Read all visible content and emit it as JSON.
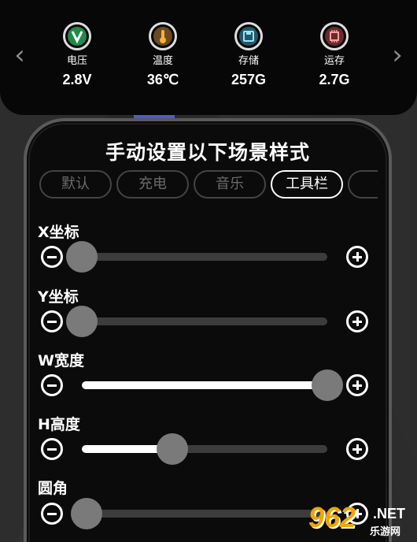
{
  "status": {
    "prev_arrow": "‹",
    "next_arrow": "›",
    "items": [
      {
        "label": "电压",
        "value": "2.8V",
        "icon": "voltage-icon"
      },
      {
        "label": "温度",
        "value": "36℃",
        "icon": "thermometer-icon"
      },
      {
        "label": "存储",
        "value": "257G",
        "icon": "storage-icon"
      },
      {
        "label": "运存",
        "value": "2.7G",
        "icon": "memory-chip-icon"
      }
    ],
    "accent": "#4a5bd6"
  },
  "panel": {
    "title": "手动设置以下场景样式",
    "tabs": [
      {
        "label": "默认",
        "active": false
      },
      {
        "label": "充电",
        "active": false
      },
      {
        "label": "音乐",
        "active": false
      },
      {
        "label": "工具栏",
        "active": true
      },
      {
        "label": "通",
        "active": false
      }
    ],
    "sliders": [
      {
        "label": "X坐标",
        "level": 0.0
      },
      {
        "label": "Y坐标",
        "level": 0.0
      },
      {
        "label": "W宽度",
        "level": 1.0
      },
      {
        "label": "H高度",
        "level": 0.37
      },
      {
        "label": "圆角",
        "level": 0.02
      }
    ]
  },
  "watermark": {
    "logo": "962",
    "net": ".NET",
    "sub": "乐游网"
  }
}
